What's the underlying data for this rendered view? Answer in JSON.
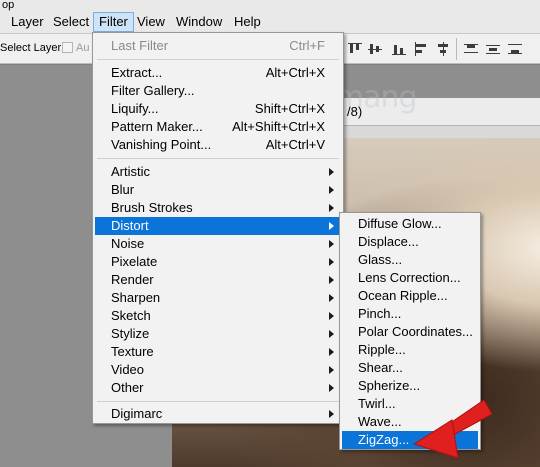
{
  "app_title_stub": "op",
  "menubar": {
    "items": [
      "Layer",
      "Select",
      "Filter",
      "View",
      "Window",
      "Help"
    ]
  },
  "options_bar": {
    "select_layer": "Select Layer",
    "auto_label": "Au",
    "auto_checked": false
  },
  "document": {
    "title_fragment": "/8)"
  },
  "watermark": {
    "text": "uantrimang"
  },
  "filter_menu": {
    "last_filter": {
      "label": "Last Filter",
      "shortcut": "Ctrl+F"
    },
    "group1": [
      {
        "label": "Extract...",
        "shortcut": "Alt+Ctrl+X"
      },
      {
        "label": "Filter Gallery...",
        "shortcut": ""
      },
      {
        "label": "Liquify...",
        "shortcut": "Shift+Ctrl+X"
      },
      {
        "label": "Pattern Maker...",
        "shortcut": "Alt+Shift+Ctrl+X"
      },
      {
        "label": "Vanishing Point...",
        "shortcut": "Alt+Ctrl+V"
      }
    ],
    "group2": [
      "Artistic",
      "Blur",
      "Brush Strokes",
      "Distort",
      "Noise",
      "Pixelate",
      "Render",
      "Sharpen",
      "Sketch",
      "Stylize",
      "Texture",
      "Video",
      "Other"
    ],
    "group3": [
      "Digimarc"
    ],
    "highlighted": "Distort"
  },
  "distort_menu": {
    "items": [
      "Diffuse Glow...",
      "Displace...",
      "Glass...",
      "Lens Correction...",
      "Ocean Ripple...",
      "Pinch...",
      "Polar Coordinates...",
      "Ripple...",
      "Shear...",
      "Spherize...",
      "Twirl...",
      "Wave...",
      "ZigZag..."
    ],
    "highlighted": "ZigZag..."
  },
  "colors": {
    "highlight": "#0a74d9",
    "annotation_arrow": "#e01f1f"
  }
}
